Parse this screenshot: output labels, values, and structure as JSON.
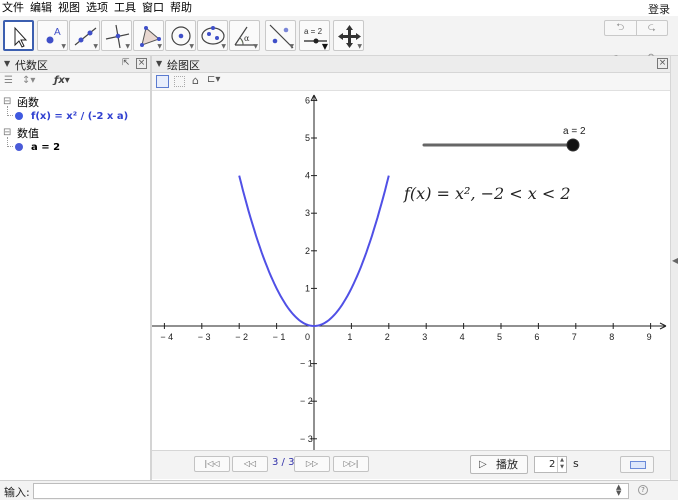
{
  "menu": [
    "文件",
    "编辑",
    "视图",
    "选项",
    "工具",
    "窗口",
    "帮助"
  ],
  "login": "登录",
  "toolbar": {
    "tools": [
      {
        "name": "move-tool",
        "icon": "arrow-pointer-icon"
      },
      {
        "name": "point-tool",
        "icon": "point-icon",
        "label": "A"
      },
      {
        "name": "line-tool",
        "icon": "line-icon"
      },
      {
        "name": "perpendicular-tool",
        "icon": "perpendicular-icon"
      },
      {
        "name": "polygon-tool",
        "icon": "polygon-icon"
      },
      {
        "name": "circle-tool",
        "icon": "circle-icon"
      },
      {
        "name": "ellipse-tool",
        "icon": "ellipse-icon"
      },
      {
        "name": "angle-tool",
        "icon": "angle-icon",
        "label": "α"
      },
      {
        "name": "reflect-tool",
        "icon": "reflect-icon"
      },
      {
        "name": "slider-tool",
        "icon": "slider-icon",
        "label": "a = 2"
      },
      {
        "name": "move-view-tool",
        "icon": "move-view-icon"
      }
    ],
    "undo": "⮌",
    "redo": "⮎",
    "help": "?",
    "settings": "⚙"
  },
  "algebra": {
    "title": "代数区",
    "categories": [
      {
        "label": "函数",
        "items": [
          "f(x) = x² / (-2 x a)"
        ]
      },
      {
        "label": "数值",
        "items": [
          "a = 2"
        ]
      }
    ]
  },
  "graphics": {
    "title": "绘图区",
    "slider_label": "a = 2",
    "function_label": "f(x) = x², −2 < x < 2",
    "curve_color": "#5050e6",
    "x_ticks": [
      "-4",
      "-3",
      "-2",
      "-1",
      "0",
      "1",
      "2",
      "3",
      "4",
      "5",
      "6",
      "7",
      "8",
      "9"
    ],
    "y_ticks": [
      "6",
      "5",
      "4",
      "3",
      "2",
      "1",
      "-1",
      "-2",
      "-3"
    ]
  },
  "playback": {
    "step": "3 / 3",
    "play_icon": "▷",
    "play_label": "播放",
    "speed": "2",
    "unit": "s"
  },
  "input": {
    "label": "输入:",
    "placeholder": ""
  }
}
